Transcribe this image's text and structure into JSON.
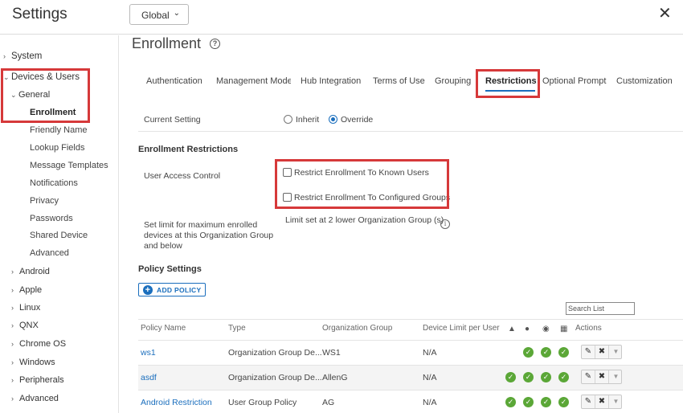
{
  "header": {
    "title": "Settings",
    "scope": "Global",
    "close": "✕"
  },
  "sidebar": {
    "items": [
      {
        "label": "System"
      },
      {
        "label": "Devices & Users"
      },
      {
        "label": "General"
      },
      {
        "label": "Enrollment"
      },
      {
        "label": "Friendly Name"
      },
      {
        "label": "Lookup Fields"
      },
      {
        "label": "Message Templates"
      },
      {
        "label": "Notifications"
      },
      {
        "label": "Privacy"
      },
      {
        "label": "Passwords"
      },
      {
        "label": "Shared Device"
      },
      {
        "label": "Advanced"
      },
      {
        "label": "Android"
      },
      {
        "label": "Apple"
      },
      {
        "label": "Linux"
      },
      {
        "label": "QNX"
      },
      {
        "label": "Chrome OS"
      },
      {
        "label": "Windows"
      },
      {
        "label": "Peripherals"
      },
      {
        "label": "Advanced"
      }
    ]
  },
  "page": {
    "title": "Enrollment",
    "tabs": [
      {
        "label": "Authentication"
      },
      {
        "label": "Management Mode"
      },
      {
        "label": "Hub Integration"
      },
      {
        "label": "Terms of Use"
      },
      {
        "label": "Grouping"
      },
      {
        "label": "Restrictions"
      },
      {
        "label": "Optional Prompt"
      },
      {
        "label": "Customization"
      }
    ],
    "current_setting": {
      "label": "Current Setting",
      "inherit": "Inherit",
      "override": "Override",
      "selected": "Override"
    },
    "restrictions": {
      "title": "Enrollment Restrictions",
      "user_access_label": "User Access Control",
      "known_users": "Restrict Enrollment To Known Users",
      "configured_groups": "Restrict Enrollment To Configured Groups",
      "limit_label_1": "Set limit for maximum enrolled",
      "limit_label_2": "devices at this Organization Group",
      "limit_label_3": "and below",
      "limit_value": "Limit set at 2 lower Organization Group (s)"
    },
    "policy": {
      "title": "Policy Settings",
      "add_button": "ADD POLICY",
      "search_placeholder": "Search List",
      "columns": [
        "Policy Name",
        "Type",
        "Organization Group",
        "Device Limit per User",
        "Actions"
      ],
      "rows": [
        {
          "name": "ws1",
          "type": "Organization Group De...",
          "group": "WS1",
          "limit": "N/A",
          "checks": 3
        },
        {
          "name": "asdf",
          "type": "Organization Group De...",
          "group": "AllenG",
          "limit": "N/A",
          "checks": 4
        },
        {
          "name": "Android Restriction",
          "type": "User Group Policy",
          "group": "AG",
          "limit": "N/A",
          "checks": 4
        }
      ]
    }
  },
  "colors": {
    "accent": "#1a6ebd",
    "highlight": "#d6393a",
    "success": "#5ba737"
  }
}
